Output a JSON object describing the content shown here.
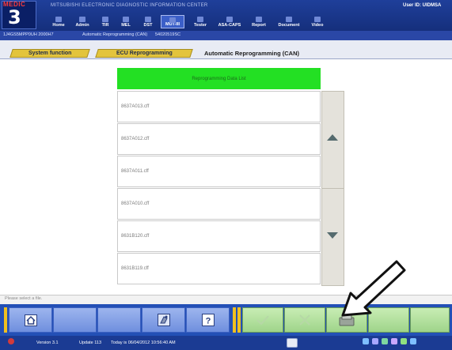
{
  "header": {
    "logo_top": "MEDIC",
    "logo_num": "3",
    "app_title": "MITSUBISHI ELECTRONIC DIAGNOSTIC INFORMATION CENTER",
    "user_label": "User ID: UIDMSA",
    "nav": [
      "Home",
      "Admin",
      "TIR",
      "MEL",
      "DST",
      "MUT-III",
      "Tester",
      "ASA-CAPS",
      "Report",
      "Document",
      "Video"
    ],
    "active_nav": "MUT-III"
  },
  "infobar": {
    "vin": "1J4GS5MPP0UH 2000H7",
    "context": "Automatic Reprogramming (CAN)",
    "module": "54020519SC"
  },
  "tabs": {
    "system_function": "System function",
    "ecu_reprogramming": "ECU Reprogramming",
    "current": "Automatic Reprogramming (CAN)"
  },
  "list": {
    "header": "Reprogramming Data List",
    "items": [
      "8637A013.cff",
      "8637A012.cff",
      "8637A011.cff",
      "8637A010.cff",
      "8631B120.cff",
      "8631B119.cff"
    ]
  },
  "status": {
    "text": "Please select a file."
  },
  "footer": {
    "version": "Version 3.1",
    "update": "Update 113",
    "date": "Today is 06/04/2012 10:56:40 AM"
  },
  "colors": {
    "header_blue": "#1f3f9a",
    "list_header_green": "#23e023",
    "tab_yellow": "#e3c43c",
    "toolbar_blue": "#2350b6"
  },
  "icons": {
    "home": "home-icon",
    "tool": "spray-icon",
    "help": "help-icon",
    "ok": "check-icon",
    "cancel": "x-icon",
    "save": "disk-icon",
    "scroll_up": "triangle-up-icon",
    "scroll_down": "triangle-down-icon"
  }
}
